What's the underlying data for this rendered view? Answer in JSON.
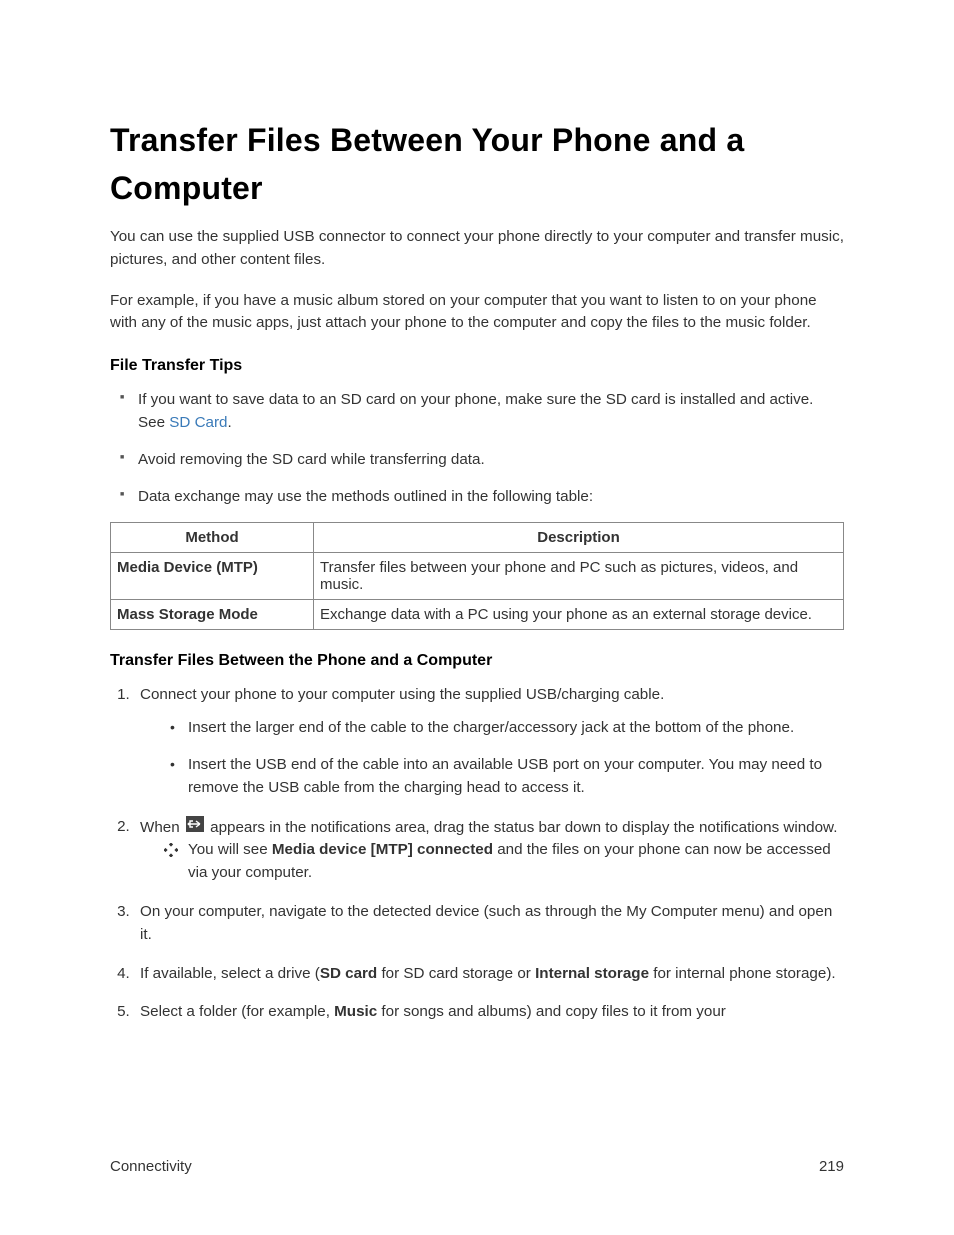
{
  "title": "Transfer Files Between Your Phone and a Computer",
  "intro1": "You can use the supplied USB connector to connect your phone directly to your computer and transfer music, pictures, and other content files.",
  "intro2": "For example, if you have a music album stored on your computer that you want to listen to on your phone with any of the music apps, just attach your phone to the computer and copy the files to the music folder.",
  "tips_heading": "File Transfer Tips",
  "tips": {
    "tip1_a": "If you want to save data to an SD card on your phone, make sure the SD card is installed and active. See ",
    "tip1_link": "SD Card",
    "tip1_b": ".",
    "tip2": "Avoid removing the SD card while transferring data.",
    "tip3": "Data exchange may use the methods outlined in the following table:"
  },
  "table": {
    "header_method": "Method",
    "header_desc": "Description",
    "rows": [
      {
        "method": "Media Device (MTP)",
        "desc": "Transfer files between your phone and PC such as pictures, videos, and music."
      },
      {
        "method": "Mass Storage Mode",
        "desc": "Exchange data with a PC using your phone as an external storage device."
      }
    ]
  },
  "steps_heading": "Transfer Files Between the Phone and a Computer",
  "steps": {
    "s1": "Connect your phone to your computer using the supplied USB/charging cable.",
    "s1_sub1": "Insert the larger end of the cable to the charger/accessory jack at the bottom of the phone.",
    "s1_sub2": "Insert the USB end of the cable into an available USB port on your computer. You may need to remove the USB cable from the charging head to access it.",
    "s2_a": "When ",
    "s2_b": " appears in the notifications area, drag the status bar down to display the notifications window.",
    "s2_note_a": "You will see ",
    "s2_note_bold": "Media device [MTP] connected",
    "s2_note_b": " and the files on your phone can now be accessed via your computer.",
    "s3": "On your computer, navigate to the detected device (such as through the My Computer menu) and open it.",
    "s4_a": "If available, select a drive (",
    "s4_bold1": "SD card",
    "s4_b": " for SD card storage or ",
    "s4_bold2": "Internal storage",
    "s4_c": " for internal phone storage).",
    "s5_a": "Select a folder (for example, ",
    "s5_bold": "Music",
    "s5_b": " for songs and albums) and copy files to it from your"
  },
  "footer": {
    "section": "Connectivity",
    "page": "219"
  }
}
